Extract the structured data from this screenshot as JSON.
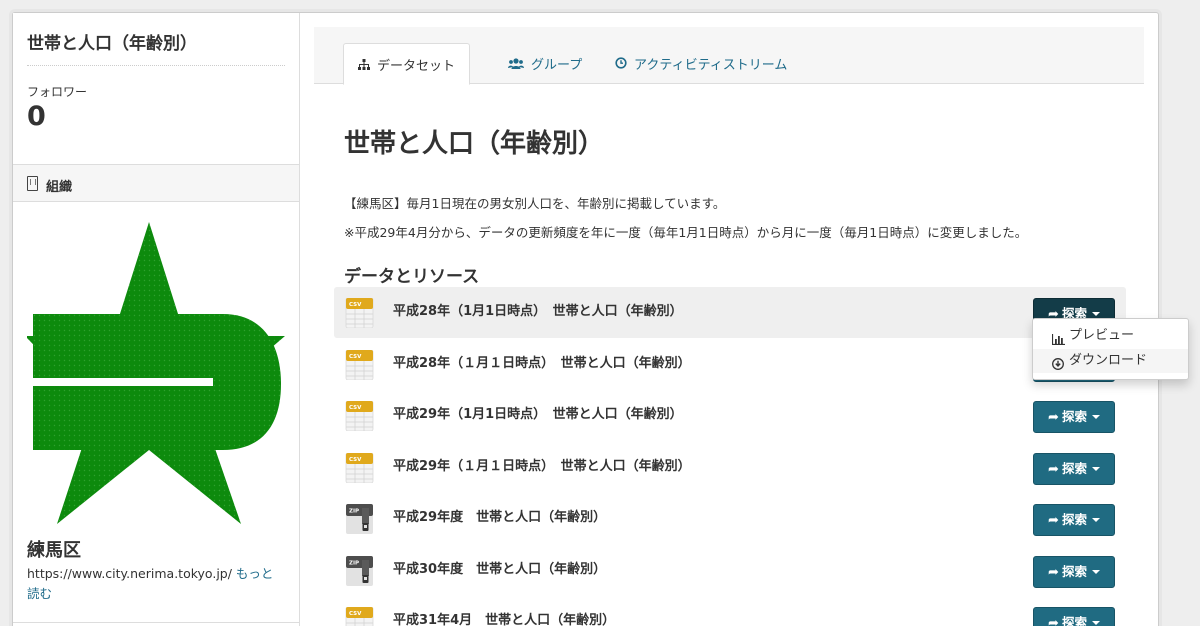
{
  "sidebar": {
    "title": "世帯と人口（年齢別）",
    "followers_label": "フォロワー",
    "followers_count": "0",
    "org_heading": "組織",
    "org_name": "練馬区",
    "org_url": "https://www.city.nerima.tokyo.jp/",
    "read_more": "もっと読む"
  },
  "tabs": [
    {
      "label": "データセット",
      "icon": "sitemap-icon",
      "active": true
    },
    {
      "label": "グループ",
      "icon": "users-icon",
      "active": false
    },
    {
      "label": "アクティビティストリーム",
      "icon": "clock-icon",
      "active": false
    }
  ],
  "main": {
    "title": "世帯と人口（年齢別）",
    "description_1": "【練馬区】毎月1日現在の男女別人口を、年齢別に掲載しています。",
    "description_2": "※平成29年4月分から、データの更新頻度を年に一度（毎年1月1日時点）から月に一度（毎月1日時点）に変更しました。",
    "resources_heading": "データとリソース"
  },
  "resources": [
    {
      "name": "平成28年（1月1日時点）　世帯と人口（年齢別）",
      "format": "CSV",
      "highlighted": true
    },
    {
      "name": "平成28年（１月１日時点）　世帯と人口（年齢別）",
      "format": "CSV",
      "highlighted": false
    },
    {
      "name": "平成29年（1月1日時点）　世帯と人口（年齢別）",
      "format": "CSV",
      "highlighted": false
    },
    {
      "name": "平成29年（１月１日時点）　世帯と人口（年齢別）",
      "format": "CSV",
      "highlighted": false
    },
    {
      "name": "平成29年度　世帯と人口（年齢別）",
      "format": "ZIP",
      "highlighted": false
    },
    {
      "name": "平成30年度　世帯と人口（年齢別）",
      "format": "ZIP",
      "highlighted": false
    },
    {
      "name": "平成31年4月　世帯と人口（年齢別）",
      "format": "CSV",
      "highlighted": false
    }
  ],
  "explore_label": "探索",
  "dropdown": {
    "items": [
      {
        "label": "プレビュー",
        "icon": "bar-chart-icon"
      },
      {
        "label": "ダウンロード",
        "icon": "download-circle-icon"
      }
    ]
  },
  "colors": {
    "button": "#206b82",
    "button_active": "#133c48",
    "link": "#1f6b8a",
    "logo_green": "#0d8a0d"
  }
}
